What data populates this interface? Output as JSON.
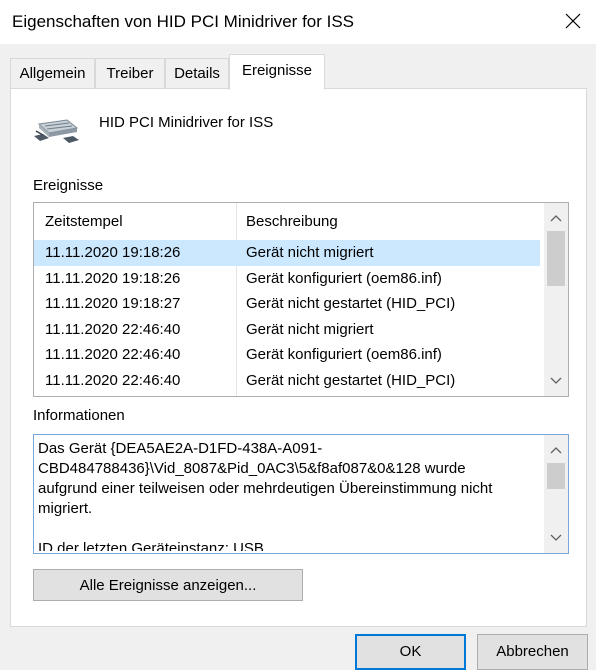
{
  "window": {
    "title": "Eigenschaften von HID PCI Minidriver for ISS"
  },
  "tabs": [
    {
      "label": "Allgemein"
    },
    {
      "label": "Treiber"
    },
    {
      "label": "Details"
    },
    {
      "label": "Ereignisse",
      "active": true
    }
  ],
  "device": {
    "name": "HID PCI Minidriver for ISS",
    "icon": "hid-device-icon"
  },
  "events": {
    "label": "Ereignisse",
    "columns": [
      "Zeitstempel",
      "Beschreibung"
    ],
    "rows": [
      {
        "time": "11.11.2020 19:18:26",
        "desc": "Gerät nicht migriert",
        "selected": true
      },
      {
        "time": "11.11.2020 19:18:26",
        "desc": "Gerät konfiguriert (oem86.inf)"
      },
      {
        "time": "11.11.2020 19:18:27",
        "desc": "Gerät nicht gestartet (HID_PCI)"
      },
      {
        "time": "11.11.2020 22:46:40",
        "desc": "Gerät nicht migriert"
      },
      {
        "time": "11.11.2020 22:46:40",
        "desc": "Gerät konfiguriert (oem86.inf)"
      },
      {
        "time": "11.11.2020 22:46:40",
        "desc": "Gerät nicht gestartet (HID_PCI)"
      }
    ]
  },
  "information": {
    "label": "Informationen",
    "text": "Das Gerät {DEA5AE2A-D1FD-438A-A091-\nCBD484788436}\\Vid_8087&Pid_0AC3\\5&f8af087&0&128 wurde\naufgrund einer teilweisen oder mehrdeutigen Übereinstimmung nicht\nmigriert.\n\nID der letzten Geräteinstanz: USB"
  },
  "buttons": {
    "show_all": "Alle Ereignisse anzeigen...",
    "ok": "OK",
    "cancel": "Abbrechen"
  },
  "colors": {
    "selection": "#cce8ff",
    "accent": "#0078d7"
  }
}
